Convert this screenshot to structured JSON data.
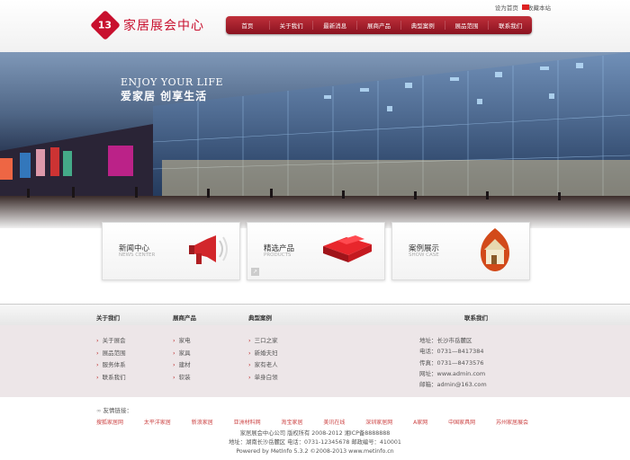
{
  "header": {
    "top_links": [
      "设为首页",
      "收藏本站"
    ],
    "logo_mark": "13",
    "logo_text": "家居展会中心"
  },
  "nav": {
    "items": [
      "首页",
      "关于我们",
      "最新消息",
      "展商产品",
      "典型案例",
      "展品范围",
      "联系我们"
    ]
  },
  "banner": {
    "slogan_en": "ENJOY YOUR LIFE",
    "slogan_cn": "爱家居  创享生活"
  },
  "boxes": [
    {
      "title": "新闻中心",
      "subtitle": "NEWS CENTER",
      "icon": "megaphone-icon"
    },
    {
      "title": "精选产品",
      "subtitle": "PRODUCTS",
      "icon": "sofa-icon"
    },
    {
      "title": "案例展示",
      "subtitle": "SHOW CASE",
      "icon": "house-icon"
    }
  ],
  "footer": {
    "col_heads": [
      "关于我们",
      "展商产品",
      "典型案例",
      "联系我们"
    ],
    "col1": [
      "关于展会",
      "展品范围",
      "服务体系",
      "联系我们"
    ],
    "col2": [
      "家电",
      "家具",
      "建材",
      "软装"
    ],
    "col3": [
      "三口之家",
      "新婚夫妇",
      "家有老人",
      "单身白领"
    ],
    "contact": [
      "地址：长沙市岳麓区",
      "电话：0731—8417384",
      "传真：0731—8473576",
      "网址：www.admin.com",
      "邮箱：admin@163.com"
    ],
    "links_title": "友情链接：",
    "links": [
      "搜狐家居网",
      "太平洋家居",
      "新浪家居",
      "亚洲材料网",
      "淘宝家居",
      "美讯在线",
      "深圳家居网",
      "A家网",
      "中国家具网",
      "苏州家居展会"
    ],
    "copyright": [
      "家居展会中心公司 版权所有 2008-2012 湘ICP备8888888",
      "地址：湖南长沙岳麓区 电话：0731-12345678 邮政编号：410001",
      "Powered by MetInfo 5.3.2 ©2008-2013 www.metinfo.cn"
    ]
  },
  "colors": {
    "brand_red": "#c8102e",
    "nav_red": "#9e1a28",
    "link_red": "#cc4444"
  }
}
